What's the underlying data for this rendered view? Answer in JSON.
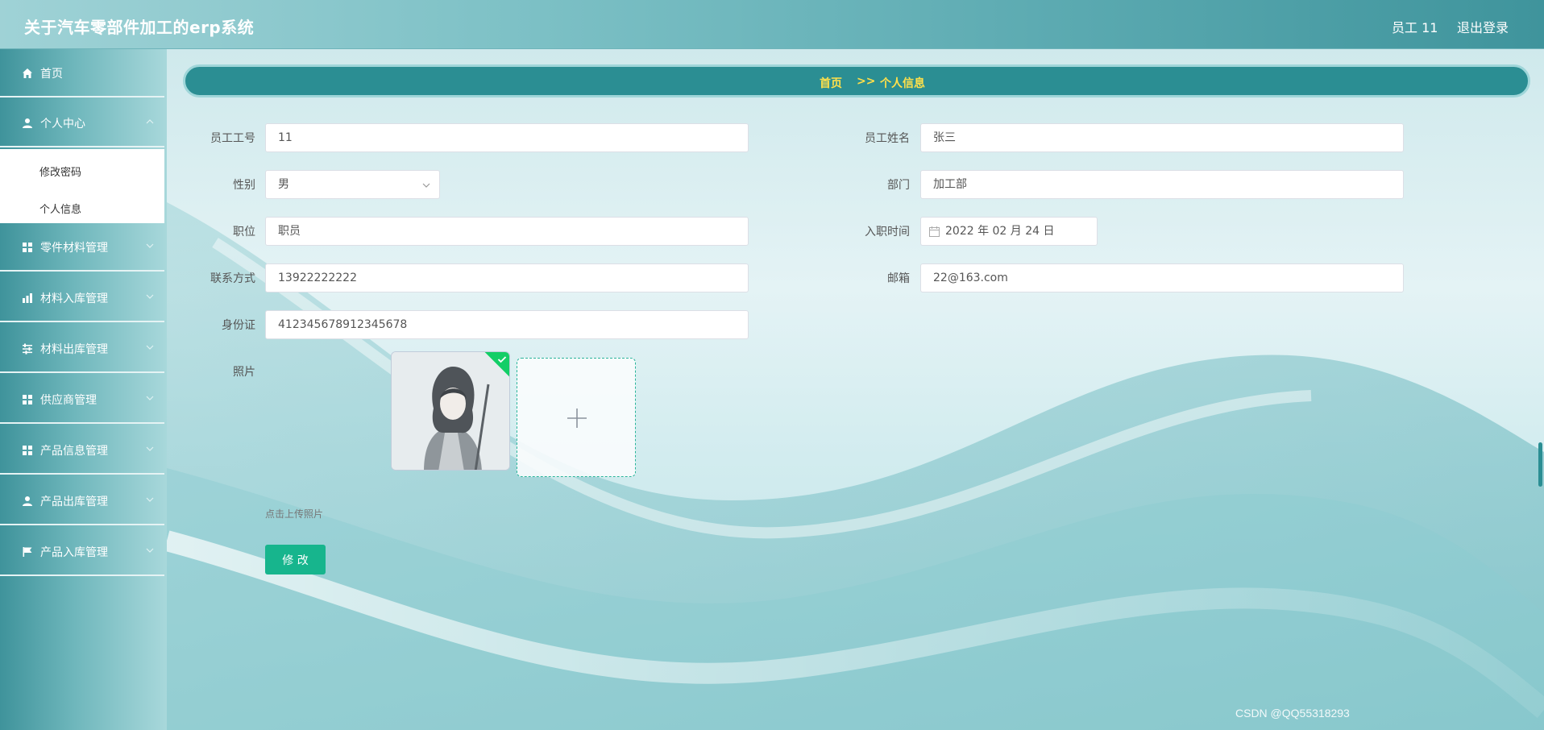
{
  "header": {
    "app_title": "关于汽车零部件加工的erp系统",
    "user_name": "员工 11",
    "logout_label": "退出登录"
  },
  "sidebar": {
    "items": [
      {
        "label": "首页",
        "icon": "home-icon"
      },
      {
        "label": "个人中心",
        "icon": "user-icon"
      },
      {
        "label": "零件材料管理",
        "icon": "grid-icon"
      },
      {
        "label": "材料入库管理",
        "icon": "chart-icon"
      },
      {
        "label": "材料出库管理",
        "icon": "sliders-icon"
      },
      {
        "label": "供应商管理",
        "icon": "grid-icon"
      },
      {
        "label": "产品信息管理",
        "icon": "grid-icon"
      },
      {
        "label": "产品出库管理",
        "icon": "user-icon"
      },
      {
        "label": "产品入库管理",
        "icon": "flag-icon"
      }
    ],
    "submenu": [
      {
        "label": "修改密码"
      },
      {
        "label": "个人信息"
      }
    ]
  },
  "breadcrumb": {
    "home": "首页",
    "separator": ">>",
    "current": "个人信息"
  },
  "form": {
    "employee_id": {
      "label": "员工工号",
      "value": "11"
    },
    "employee_name": {
      "label": "员工姓名",
      "value": "张三"
    },
    "gender": {
      "label": "性别",
      "value": "男"
    },
    "department": {
      "label": "部门",
      "value": "加工部"
    },
    "position": {
      "label": "职位",
      "value": "职员"
    },
    "hire_date": {
      "label": "入职时间",
      "value": "2022 年 02 月 24 日"
    },
    "phone": {
      "label": "联系方式",
      "value": "13922222222"
    },
    "email": {
      "label": "邮箱",
      "value": "22@163.com"
    },
    "id_card": {
      "label": "身份证",
      "value": "412345678912345678"
    },
    "photo": {
      "label": "照片",
      "hint": "点击上传照片"
    },
    "submit_label": "修 改"
  },
  "watermark": "CSDN @QQ55318293",
  "colors": {
    "accent": "#2b8e93",
    "breadcrumb_text": "#ffe04a",
    "submit": "#17b58d",
    "success": "#13ce66"
  }
}
